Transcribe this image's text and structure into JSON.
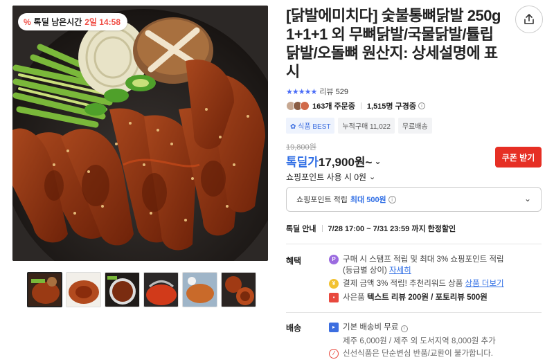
{
  "badge": {
    "label": "톡딜 남은시간",
    "time": "2일 14:58"
  },
  "product": {
    "title": "[닭발에미치다] 숯불통뼈닭발 250g 1+1+1 외 무뼈닭발/국물닭발/튤립닭발/오돌뼈 원산지: 상세설명에 표시",
    "review_label": "리뷰",
    "review_count": "529",
    "orders": "163개 주문중",
    "subscribers": "1,515명 구경중",
    "tags": [
      "식품 BEST",
      "누적구매 11,022",
      "무료배송"
    ],
    "original_price": "19,800원",
    "price_label": "톡딜가",
    "price": "17,900원~",
    "coupon": "쿠폰 받기",
    "point_use": "쇼핑포인트 사용 시 0원",
    "point_save_prefix": "쇼핑포인트 적립",
    "point_save_max": "최대 500원",
    "sale_label": "톡딜 안내",
    "sale_period": "7/28 17:00 ~ 7/31 23:59 까지 한정할인"
  },
  "benefits": {
    "label": "혜택",
    "items": [
      {
        "text": "구매 시 스탬프 적립 및 최대 3% 쇼핑포인트 적립",
        "text2": "(등급별 상이)",
        "link": "자세히"
      },
      {
        "text": "결제 금액 3% 적립! 추천리워드 상품",
        "link": "상품 더보기"
      },
      {
        "text": "사은품",
        "bold": "텍스트 리뷰 200원 / 포토리뷰 500원"
      }
    ]
  },
  "shipping": {
    "label": "배송",
    "fee": "기본 배송비 무료",
    "extra": "제주 6,000원 / 제주 외 도서지역 8,000원 추가",
    "notice": "신선식품은 단순변심 반품/교환이 불가합니다."
  },
  "icons": [
    "percent-icon",
    "share-icon",
    "star-icon",
    "info-icon",
    "chevron-down-icon",
    "point-icon",
    "coin-icon",
    "gift-icon",
    "truck-icon",
    "prohibit-icon"
  ]
}
